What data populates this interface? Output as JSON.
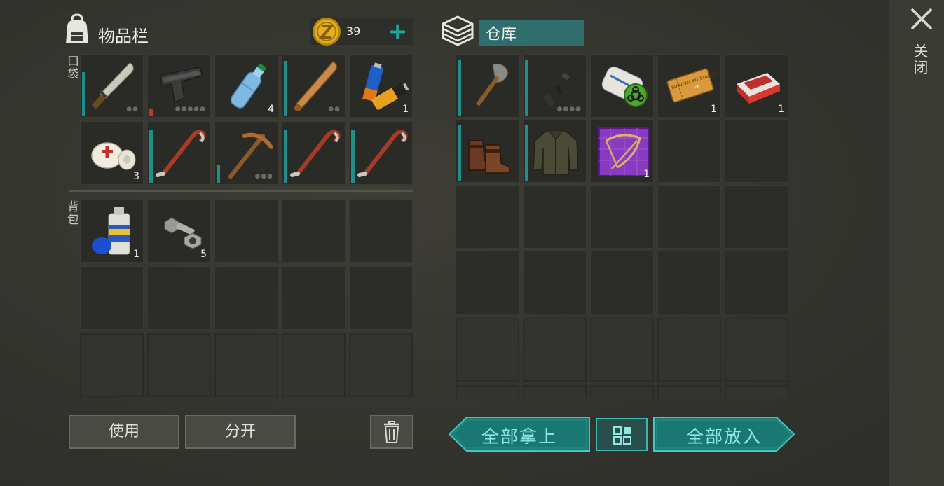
{
  "inventory": {
    "title": "物品栏",
    "pocket_label": "口袋",
    "backpack_label": "背包",
    "coins": "39",
    "add_label": "+",
    "pocket_slots": [
      {
        "item": "machete",
        "durability": 0.75,
        "dots": "●●"
      },
      {
        "item": "pistol",
        "durability": 0.1,
        "bar_color": "#c0392b",
        "dots": "●●●●●"
      },
      {
        "item": "water-bottle",
        "count": "4"
      },
      {
        "item": "baseball-bat",
        "durability": 0.9,
        "dots": "●●"
      },
      {
        "item": "batteries",
        "count": "1"
      },
      {
        "item": "bandage",
        "count": "3"
      },
      {
        "item": "crowbar",
        "durability": 0.85
      },
      {
        "item": "pickaxe",
        "durability": 0.28,
        "dots": "●●●"
      },
      {
        "item": "crowbar",
        "durability": 0.85
      },
      {
        "item": "crowbar",
        "durability": 0.85
      }
    ],
    "backpack_slots": [
      {
        "item": "spray-paint",
        "count": "1"
      },
      {
        "item": "bolt-and-nut",
        "count": "5"
      }
    ]
  },
  "warehouse": {
    "title": "仓库",
    "slots": [
      {
        "item": "shovel",
        "durability": 0.9
      },
      {
        "item": "assault-rifle",
        "durability": 0.9,
        "dots": "●●●●"
      },
      {
        "item": "biohazard-blueprint"
      },
      {
        "item": "survival-kit-coupon",
        "count": "1",
        "coupon_text": "SURVIVAL KIT COUPON"
      },
      {
        "item": "cigarette-pack",
        "count": "1"
      },
      {
        "item": "boots"
      },
      {
        "item": "jacket"
      },
      {
        "item": "crossbow-blueprint",
        "count": "1"
      }
    ]
  },
  "buttons": {
    "use": "使用",
    "split": "分开",
    "take_all": "全部拿上",
    "put_all": "全部放入"
  },
  "close_label": "关闭"
}
